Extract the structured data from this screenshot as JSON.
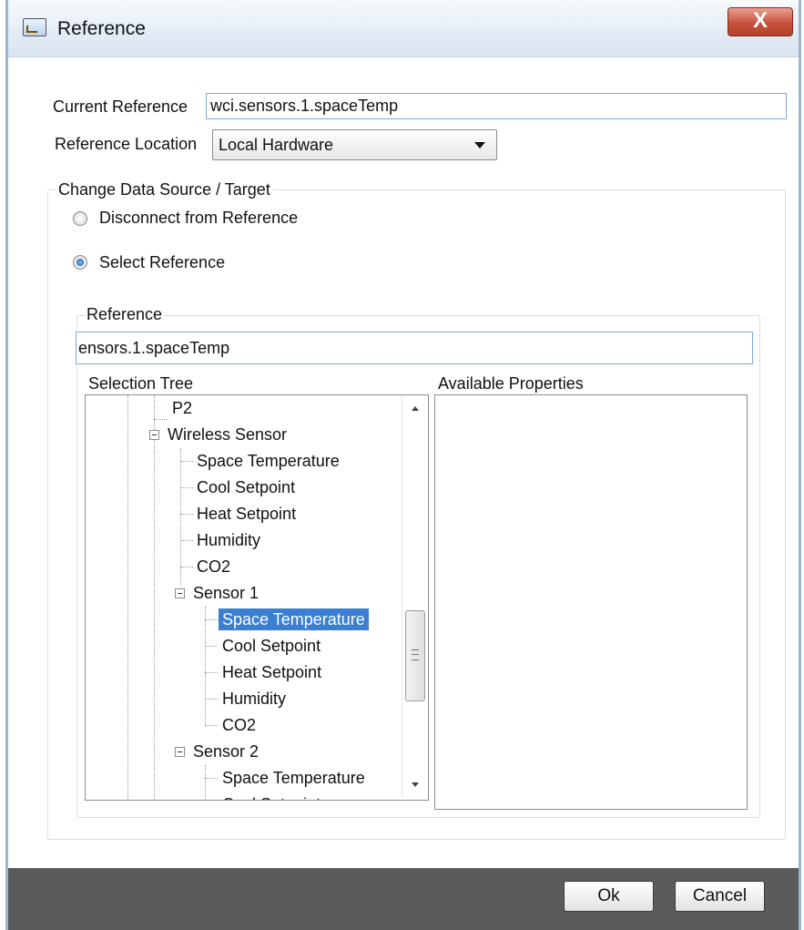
{
  "window": {
    "title": "Reference",
    "close_glyph": "X",
    "icon": "window-app-icon"
  },
  "current_reference": {
    "label": "Current Reference",
    "value": "wci.sensors.1.spaceTemp"
  },
  "reference_location": {
    "label": "Reference Location",
    "selected": "Local Hardware"
  },
  "change_group": {
    "legend": "Change Data Source / Target",
    "options": [
      {
        "label": "Disconnect from Reference",
        "selected": false
      },
      {
        "label": "Select Reference",
        "selected": true
      }
    ]
  },
  "reference_group": {
    "legend": "Reference",
    "value": "ensors.1.spaceTemp"
  },
  "selection_tree": {
    "label": "Selection Tree",
    "nodes": [
      {
        "label": "P2",
        "level": 2,
        "expandable": false,
        "selected": false
      },
      {
        "label": "Wireless Sensor",
        "level": 1,
        "expandable": true,
        "selected": false
      },
      {
        "label": "Space Temperature",
        "level": 2,
        "expandable": false,
        "selected": false
      },
      {
        "label": "Cool Setpoint",
        "level": 2,
        "expandable": false,
        "selected": false
      },
      {
        "label": "Heat Setpoint",
        "level": 2,
        "expandable": false,
        "selected": false
      },
      {
        "label": "Humidity",
        "level": 2,
        "expandable": false,
        "selected": false
      },
      {
        "label": "CO2",
        "level": 2,
        "expandable": false,
        "selected": false
      },
      {
        "label": "Sensor 1",
        "level": 2,
        "expandable": true,
        "selected": false
      },
      {
        "label": "Space Temperature",
        "level": 3,
        "expandable": false,
        "selected": true
      },
      {
        "label": "Cool Setpoint",
        "level": 3,
        "expandable": false,
        "selected": false
      },
      {
        "label": "Heat Setpoint",
        "level": 3,
        "expandable": false,
        "selected": false
      },
      {
        "label": "Humidity",
        "level": 3,
        "expandable": false,
        "selected": false
      },
      {
        "label": "CO2",
        "level": 3,
        "expandable": false,
        "selected": false
      },
      {
        "label": "Sensor 2",
        "level": 2,
        "expandable": true,
        "selected": false
      },
      {
        "label": "Space Temperature",
        "level": 3,
        "expandable": false,
        "selected": false
      },
      {
        "label": "Cool Setpoint",
        "level": 3,
        "expandable": false,
        "selected": false
      }
    ]
  },
  "available_properties": {
    "label": "Available Properties",
    "items": []
  },
  "buttons": {
    "ok": "Ok",
    "cancel": "Cancel"
  },
  "colors": {
    "selection": "#3a7fd3",
    "footer": "#5b5b5b",
    "close_button": "#c5523c",
    "field_border": "#7fa9d8"
  }
}
